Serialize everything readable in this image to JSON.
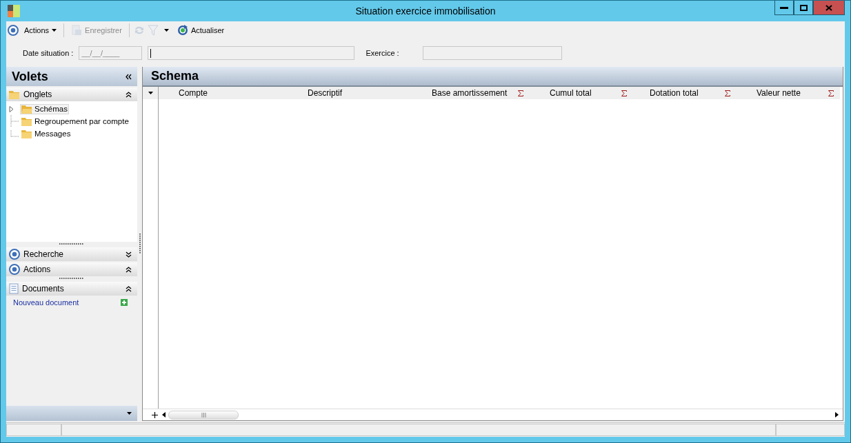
{
  "window": {
    "title": "Situation exercice immobilisation"
  },
  "toolbar": [
    {
      "kind": "icon"
    },
    {
      "kind": "menu",
      "label": "Actions"
    },
    {
      "kind": "separator"
    },
    {
      "kind": "button",
      "label": "Enregistrer",
      "disabled": true
    },
    {
      "kind": "separator"
    },
    {
      "kind": "icon",
      "disabled": true
    },
    {
      "kind": "icon",
      "disabled": true
    },
    {
      "kind": "caret"
    },
    {
      "kind": "button",
      "label": "Actualiser",
      "disabled": false
    }
  ],
  "form": {
    "date_label": "Date situation :",
    "date_value": "__/__/____",
    "exercice_label": "Exercice :"
  },
  "sidebar": {
    "title": "Volets",
    "sections": [
      {
        "title": "Onglets",
        "expanded": true,
        "tree": [
          {
            "label": "Schémas",
            "selected": true,
            "has_children": true
          },
          {
            "label": "Regroupement par compte",
            "selected": false,
            "has_children": false
          },
          {
            "label": "Messages",
            "selected": false,
            "has_children": false
          }
        ]
      },
      {
        "title": "Recherche",
        "expanded": false
      },
      {
        "title": "Actions",
        "expanded": true
      },
      {
        "title": "Documents",
        "expanded": true,
        "links": [
          "Nouveau document"
        ]
      }
    ]
  },
  "main": {
    "title": "Schema",
    "columns": [
      {
        "label": "Compte",
        "sum": false
      },
      {
        "label": "Descriptif",
        "sum": false
      },
      {
        "label": "Base amortissement",
        "sum": true
      },
      {
        "label": "Cumul total",
        "sum": true
      },
      {
        "label": "Dotation total",
        "sum": true
      },
      {
        "label": "Valeur nette",
        "sum": true
      }
    ]
  }
}
